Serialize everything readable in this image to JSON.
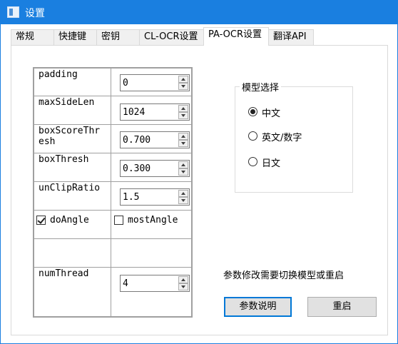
{
  "window": {
    "title": "设置",
    "icon": "settings-window-icon"
  },
  "tabs": [
    {
      "label": "常规"
    },
    {
      "label": "快捷键"
    },
    {
      "label": "密钥"
    },
    {
      "label": "CL-OCR设置"
    },
    {
      "label": "PA-OCR设置",
      "active": true
    },
    {
      "label": "翻译API"
    }
  ],
  "params": {
    "padding": {
      "label": "padding",
      "value": "0"
    },
    "maxSideLen": {
      "label": "maxSideLen",
      "value": "1024"
    },
    "boxScoreThresh": {
      "label_line1": "boxScoreThr",
      "label_line2": "esh",
      "value": "0.700"
    },
    "boxThresh": {
      "label": "boxThresh",
      "value": "0.300"
    },
    "unClipRatio": {
      "label": "unClipRatio",
      "value": "1.5"
    },
    "doAngle": {
      "label": "doAngle",
      "checked": true
    },
    "mostAngle": {
      "label": "mostAngle",
      "checked": false
    },
    "numThread": {
      "label": "numThread",
      "value": "4"
    }
  },
  "model_select": {
    "title": "模型选择",
    "options": [
      {
        "label": "中文",
        "selected": true
      },
      {
        "label": "英文/数字",
        "selected": false
      },
      {
        "label": "日文",
        "selected": false
      }
    ]
  },
  "notice": "参数修改需要切换模型或重启",
  "buttons": {
    "help": "参数说明",
    "restart": "重启"
  },
  "colors": {
    "titlebar": "#1a7fe0",
    "accent": "#0078d7",
    "tab_inactive": "#f0f0f0",
    "button": "#e1e1e1"
  }
}
